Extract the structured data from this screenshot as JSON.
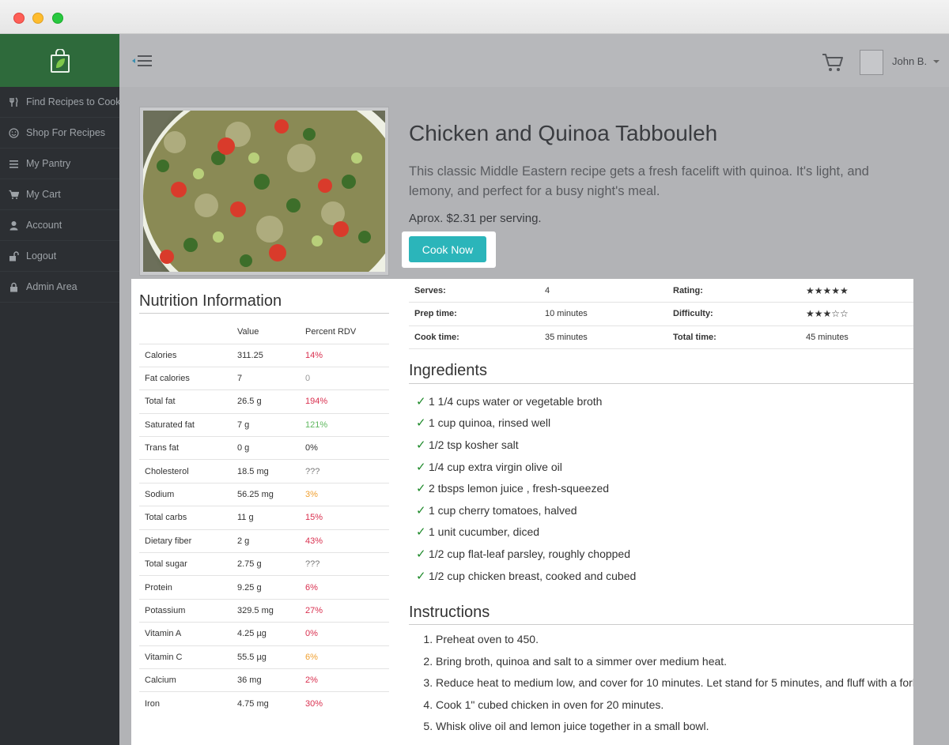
{
  "user": {
    "name": "John B."
  },
  "sidebar": {
    "items": [
      {
        "label": "Find Recipes to Cook",
        "icon": "utensils-icon"
      },
      {
        "label": "Shop For Recipes",
        "icon": "smile-icon"
      },
      {
        "label": "My Pantry",
        "icon": "list-icon"
      },
      {
        "label": "My Cart",
        "icon": "cart-icon"
      },
      {
        "label": "Account",
        "icon": "user-icon"
      },
      {
        "label": "Logout",
        "icon": "unlock-icon"
      },
      {
        "label": "Admin Area",
        "icon": "lock-icon"
      }
    ]
  },
  "recipe": {
    "title": "Chicken and Quinoa Tabbouleh",
    "description": "This classic Middle Eastern recipe gets a fresh facelift with quinoa. It's light, and lemony, and perfect for a busy night's meal.",
    "price": "Aprox. $2.31 per serving.",
    "cook_button": "Cook Now"
  },
  "meta": {
    "serves_label": "Serves:",
    "serves": "4",
    "rating_label": "Rating:",
    "rating": "★★★★★",
    "rating_value": 5,
    "prep_label": "Prep time:",
    "prep": "10 minutes",
    "difficulty_label": "Difficulty:",
    "difficulty": "★★★☆☆",
    "difficulty_value": 3,
    "cook_label": "Cook time:",
    "cook": "35 minutes",
    "total_label": "Total time:",
    "total": "45 minutes"
  },
  "nutrition": {
    "title": "Nutrition Information",
    "headers": [
      "",
      "Value",
      "Percent RDV"
    ],
    "rows": [
      {
        "name": "Calories",
        "value": "311.25",
        "rdv": "14%",
        "color": "#d9304f"
      },
      {
        "name": "Fat calories",
        "value": "7",
        "rdv": "0",
        "color": "#999999"
      },
      {
        "name": "Total fat",
        "value": "26.5 g",
        "rdv": "194%",
        "color": "#d9304f"
      },
      {
        "name": "Saturated fat",
        "value": "7 g",
        "rdv": "121%",
        "color": "#5fb85f"
      },
      {
        "name": "Trans fat",
        "value": "0 g",
        "rdv": "0%",
        "color": "#333333"
      },
      {
        "name": "Cholesterol",
        "value": "18.5 mg",
        "rdv": "???",
        "color": "#777777"
      },
      {
        "name": "Sodium",
        "value": "56.25 mg",
        "rdv": "3%",
        "color": "#f0a030"
      },
      {
        "name": "Total carbs",
        "value": "11 g",
        "rdv": "15%",
        "color": "#d9304f"
      },
      {
        "name": "Dietary fiber",
        "value": "2 g",
        "rdv": "43%",
        "color": "#d9304f"
      },
      {
        "name": "Total sugar",
        "value": "2.75 g",
        "rdv": "???",
        "color": "#777777"
      },
      {
        "name": "Protein",
        "value": "9.25 g",
        "rdv": "6%",
        "color": "#d9304f"
      },
      {
        "name": "Potassium",
        "value": "329.5 mg",
        "rdv": "27%",
        "color": "#d9304f"
      },
      {
        "name": "Vitamin A",
        "value": "4.25 µg",
        "rdv": "0%",
        "color": "#d9304f"
      },
      {
        "name": "Vitamin C",
        "value": "55.5 µg",
        "rdv": "6%",
        "color": "#f0a030"
      },
      {
        "name": "Calcium",
        "value": "36 mg",
        "rdv": "2%",
        "color": "#d9304f"
      },
      {
        "name": "Iron",
        "value": "4.75 mg",
        "rdv": "30%",
        "color": "#d9304f"
      }
    ]
  },
  "ingredients": {
    "title": "Ingredients",
    "items": [
      "1 1/4 cups water or vegetable broth",
      "1 cup quinoa, rinsed well",
      "1/2 tsp kosher salt",
      "1/4 cup extra virgin olive oil",
      "2 tbsps lemon juice , fresh-squeezed",
      "1 cup cherry tomatoes, halved",
      "1 unit cucumber, diced",
      "1/2 cup flat-leaf parsley, roughly chopped",
      "1/2 cup chicken breast, cooked and cubed"
    ]
  },
  "instructions": {
    "title": "Instructions",
    "steps": [
      "Preheat oven to 450.",
      "Bring broth, quinoa and salt to a simmer over medium heat.",
      "Reduce heat to medium low, and cover for 10 minutes. Let stand for 5 minutes, and fluff with a fork.",
      "Cook 1\" cubed chicken in oven for 20 minutes.",
      "Whisk olive oil and lemon juice together in a small bowl."
    ]
  },
  "colors": {
    "accent": "#2bb5ba",
    "brand": "#2e6a3b",
    "check": "#1e8a2a"
  }
}
